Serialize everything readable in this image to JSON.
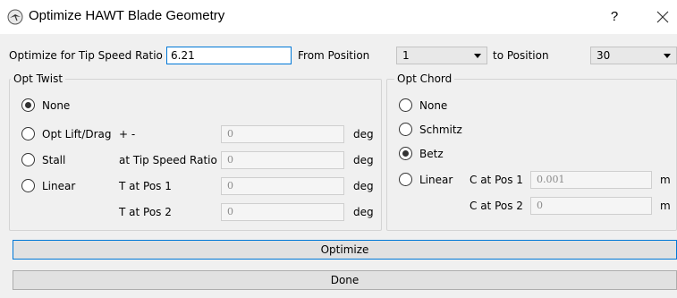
{
  "window": {
    "title": "Optimize HAWT Blade Geometry",
    "help_label": "?",
    "app_icon": "bird-icon",
    "close_icon": "close-icon"
  },
  "top": {
    "tsr_label": "Optimize for Tip Speed Ratio",
    "tsr_value": "6.21",
    "from_label": "From Position",
    "from_value": "1",
    "to_label": "to Position",
    "to_value": "30"
  },
  "twist": {
    "title": "Opt Twist",
    "options": [
      "None",
      "Opt Lift/Drag",
      "Stall",
      "Linear"
    ],
    "selected": "None",
    "fields": [
      {
        "label": "+ -",
        "value": "0",
        "unit": "deg"
      },
      {
        "label": "at Tip Speed Ratio",
        "value": "0",
        "unit": "deg"
      },
      {
        "label": "T at Pos 1",
        "value": "0",
        "unit": "deg"
      },
      {
        "label": "T at Pos 2",
        "value": "0",
        "unit": "deg"
      }
    ]
  },
  "chord": {
    "title": "Opt Chord",
    "options": [
      "None",
      "Schmitz",
      "Betz",
      "Linear"
    ],
    "selected": "Betz",
    "fields": [
      {
        "label": "C at Pos 1",
        "value": "0.001",
        "unit": "m"
      },
      {
        "label": "C at Pos 2",
        "value": "0",
        "unit": "m"
      }
    ]
  },
  "buttons": {
    "optimize": "Optimize",
    "done": "Done"
  }
}
